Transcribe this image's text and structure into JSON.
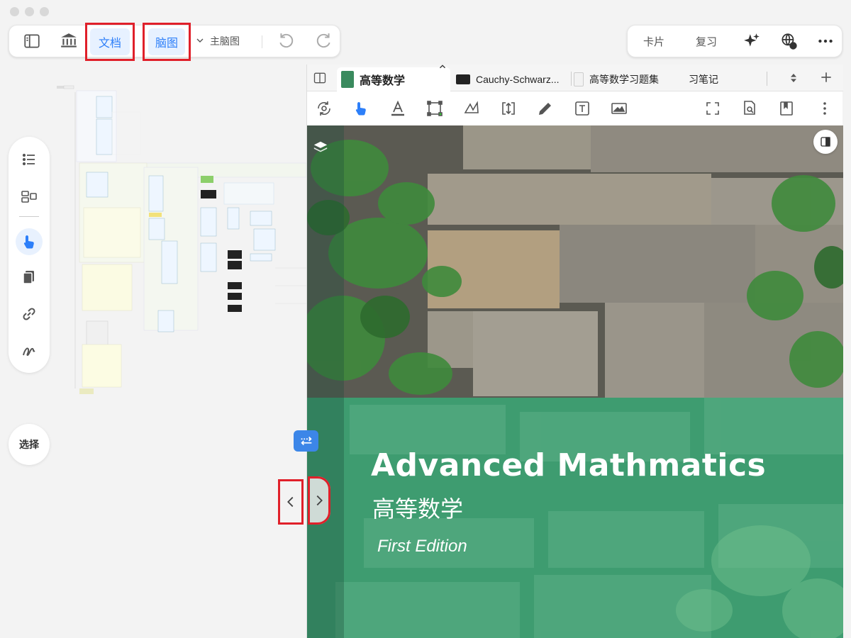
{
  "top_left_toolbar": {
    "doc_label": "文档",
    "mindmap_label": "脑图",
    "main_mindmap_label": "主脑图"
  },
  "top_right_toolbar": {
    "cards_label": "卡片",
    "review_label": "复习"
  },
  "sidebar": {
    "select_label": "选择"
  },
  "viewer": {
    "tabs": [
      {
        "label": "高等数学",
        "active": true
      },
      {
        "label": "Cauchy-Schwarz...",
        "active": false
      },
      {
        "label": "高等数学习题集",
        "active": false
      },
      {
        "label": "习笔记",
        "active": false
      }
    ],
    "cover": {
      "title": "Advanced Mathmatics",
      "subtitle": "高等数学",
      "edition": "First Edition"
    }
  },
  "colors": {
    "accent": "#2d7ff9",
    "highlight_box": "#e0202a",
    "cover_green": "#3a9a6d"
  },
  "icons": [
    "sidebar-toggle-icon",
    "library-icon",
    "undo-icon",
    "redo-icon",
    "sparkle-icon",
    "web-help-icon",
    "more-icon"
  ]
}
